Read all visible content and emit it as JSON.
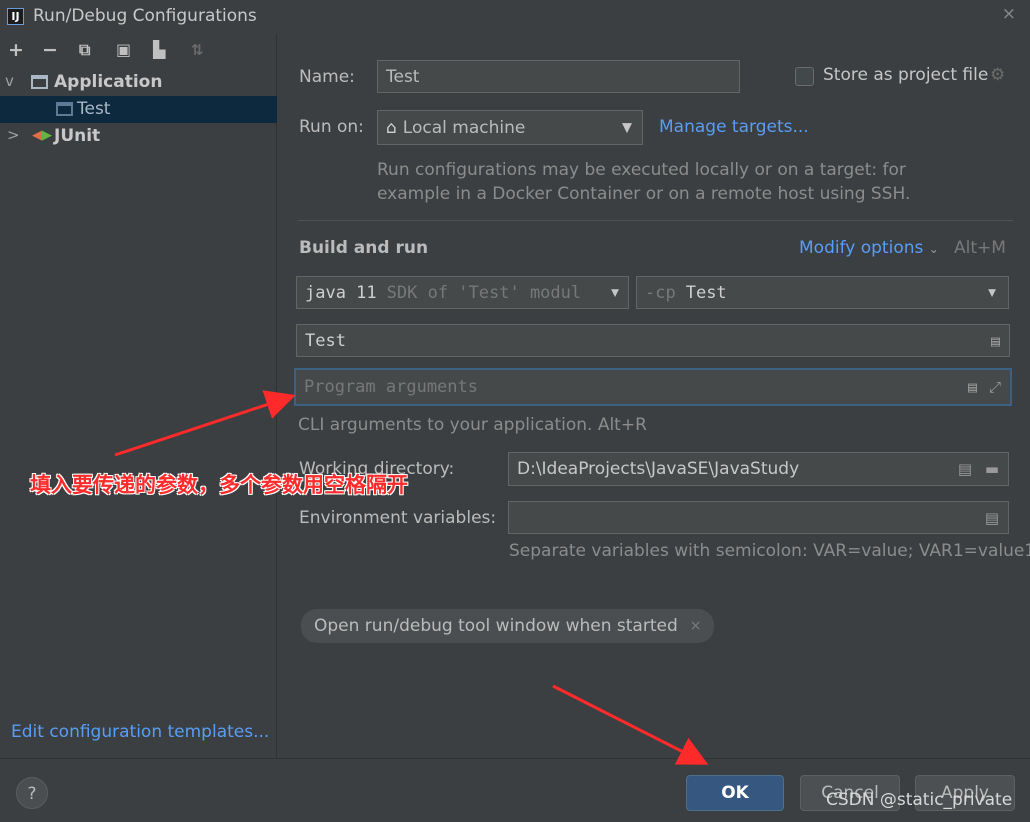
{
  "window": {
    "title": "Run/Debug Configurations",
    "app_icon": "intellij-icon",
    "close_glyph": "×"
  },
  "toolbar": {
    "items": [
      {
        "name": "add-icon",
        "glyph": "+"
      },
      {
        "name": "remove-icon",
        "glyph": "−"
      },
      {
        "name": "copy-icon",
        "glyph": "⧉"
      },
      {
        "name": "save-icon",
        "glyph": "▣"
      },
      {
        "name": "folder-icon",
        "glyph": "▙"
      },
      {
        "name": "sort-icon",
        "glyph": "⇅"
      }
    ]
  },
  "tree": {
    "application": {
      "label": "Application",
      "chevron": "v"
    },
    "test": {
      "label": "Test"
    },
    "junit": {
      "label": "JUnit",
      "chevron": ">"
    }
  },
  "edit_templates": "Edit configuration templates...",
  "form": {
    "name_label": "Name:",
    "name_value": "Test",
    "store_label": "Store as project file",
    "run_on_label": "Run on:",
    "run_on_value": "Local machine",
    "manage_targets": "Manage targets...",
    "run_hint_line1": "Run configurations may be executed locally or on a target: for",
    "run_hint_line2": "example in a Docker Container or on a remote host using SSH.",
    "build_title": "Build and run",
    "modify_options": "Modify options",
    "modify_shortcut": "Alt+M",
    "jdk_strong": "java 11",
    "jdk_dim": "SDK of 'Test' modul",
    "cp_dim": "-cp",
    "cp_value": "Test",
    "main_class": "Test",
    "program_args_placeholder": "Program arguments",
    "cli_hint": "CLI arguments to your application. Alt+R",
    "workdir_label": "Working directory:",
    "workdir_value": "D:\\IdeaProjects\\JavaSE\\JavaStudy",
    "env_label": "Environment variables:",
    "env_value": "",
    "env_hint": "Separate variables with semicolon: VAR=value; VAR1=value1",
    "chip_label": "Open run/debug tool window when started",
    "chip_close": "×"
  },
  "buttons": {
    "help": "?",
    "ok": "OK",
    "cancel": "Cancel",
    "apply": "Apply"
  },
  "annotation": "填入要传递的参数，多个参数用空格隔开",
  "watermark": "CSDN @static_private",
  "colors": {
    "accent": "#589df6",
    "selection": "#0d293e",
    "primary_button": "#365880",
    "annotation": "#ff2a2a"
  }
}
